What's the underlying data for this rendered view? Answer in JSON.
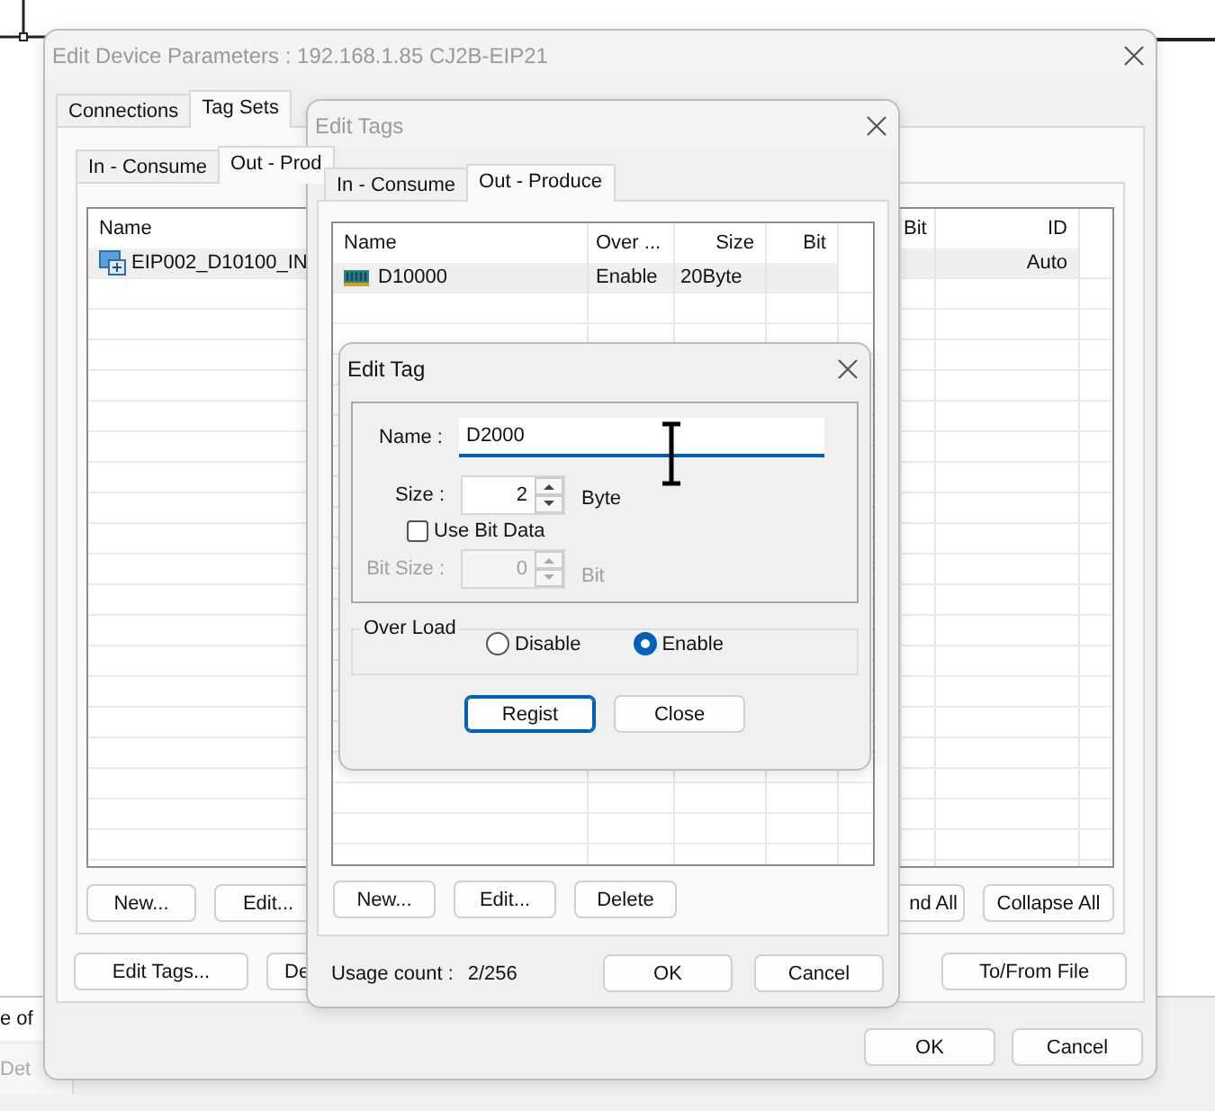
{
  "main_window": {
    "title": "Edit Device Parameters : 192.168.1.85 CJ2B-EIP21",
    "tabs": [
      {
        "label": "Connections",
        "selected": false
      },
      {
        "label": "Tag Sets",
        "selected": true
      }
    ],
    "sub_tabs": [
      {
        "label": "In - Consume",
        "selected": false
      },
      {
        "label": "Out - Prod",
        "selected": true
      }
    ],
    "table": {
      "columns": [
        "Name",
        "Bit",
        "ID"
      ],
      "rows": [
        {
          "name": "EIP002_D10100_IN",
          "bit": "",
          "id": "Auto"
        }
      ]
    },
    "list_buttons_left": [
      "New...",
      "Edit..."
    ],
    "list_buttons_right": [
      "nd All",
      "Collapse All"
    ],
    "action_buttons_left": [
      "Edit Tags...",
      "De"
    ],
    "action_buttons_right": [
      "To/From File"
    ],
    "footer_buttons": [
      "OK",
      "Cancel"
    ]
  },
  "edit_tags": {
    "title": "Edit Tags",
    "tabs": [
      {
        "label": "In - Consume",
        "selected": false
      },
      {
        "label": "Out - Produce",
        "selected": true
      }
    ],
    "table": {
      "columns": [
        "Name",
        "Over ...",
        "Size",
        "Bit"
      ],
      "rows": [
        {
          "name": "D10000",
          "over_load": "Enable",
          "size": "20Byte",
          "bit": ""
        }
      ]
    },
    "list_buttons": [
      "New...",
      "Edit...",
      "Delete"
    ],
    "usage_label": "Usage count :",
    "usage_value": "2/256",
    "footer_buttons": [
      "OK",
      "Cancel"
    ]
  },
  "edit_tag": {
    "title": "Edit Tag",
    "name_label": "Name :",
    "name_value": "D2000",
    "size_label": "Size :",
    "size_value": "2",
    "size_unit": "Byte",
    "use_bit_data": {
      "label": "Use Bit Data",
      "checked": false
    },
    "bit_size": {
      "label": "Bit Size :",
      "value": "0",
      "unit": "Bit",
      "disabled": true
    },
    "over_load": {
      "legend": "Over Load",
      "options": [
        {
          "label": "Disable",
          "selected": false
        },
        {
          "label": "Enable",
          "selected": true
        }
      ]
    },
    "buttons": [
      {
        "label": "Regist",
        "focused": true
      },
      {
        "label": "Close",
        "focused": false
      }
    ]
  },
  "background": {
    "text": "e of",
    "tab": "Det"
  }
}
